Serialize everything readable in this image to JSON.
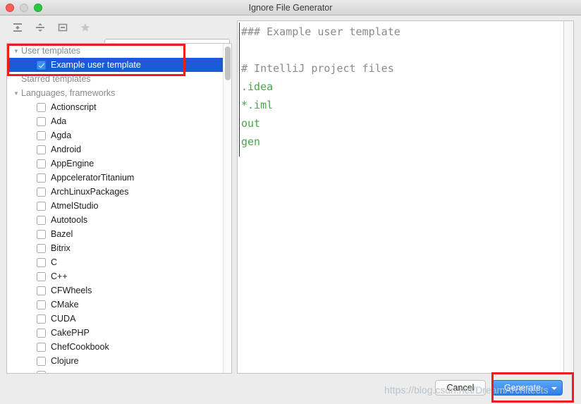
{
  "window": {
    "title": "Ignore File Generator",
    "controls": [
      {
        "name": "close",
        "label": "Close"
      },
      {
        "name": "minimize",
        "label": "Minimize"
      },
      {
        "name": "zoom",
        "label": "Zoom"
      }
    ]
  },
  "toolbar": {
    "buttons": [
      {
        "icon": "expand-all-icon",
        "label": "Expand All"
      },
      {
        "icon": "collapse-all-icon",
        "label": "Collapse All"
      },
      {
        "icon": "panel-toggle-icon",
        "label": "Toggle Panel"
      },
      {
        "icon": "star-icon",
        "label": "Star"
      }
    ]
  },
  "search": {
    "icon": "search-icon",
    "value": "",
    "placeholder": ""
  },
  "tree": {
    "groups": [
      {
        "label": "User templates",
        "expanded": true
      },
      {
        "label": "Starred templates",
        "expanded": false
      },
      {
        "label": "Languages, frameworks",
        "expanded": true
      }
    ],
    "user_template": {
      "label": "Example user template",
      "checked": true,
      "selected": true
    },
    "items": [
      {
        "label": "Actionscript",
        "checked": false
      },
      {
        "label": "Ada",
        "checked": false
      },
      {
        "label": "Agda",
        "checked": false
      },
      {
        "label": "Android",
        "checked": false
      },
      {
        "label": "AppEngine",
        "checked": false
      },
      {
        "label": "AppceleratorTitanium",
        "checked": false
      },
      {
        "label": "ArchLinuxPackages",
        "checked": false
      },
      {
        "label": "AtmelStudio",
        "checked": false
      },
      {
        "label": "Autotools",
        "checked": false
      },
      {
        "label": "Bazel",
        "checked": false
      },
      {
        "label": "Bitrix",
        "checked": false
      },
      {
        "label": "C",
        "checked": false
      },
      {
        "label": "C++",
        "checked": false
      },
      {
        "label": "CFWheels",
        "checked": false
      },
      {
        "label": "CMake",
        "checked": false
      },
      {
        "label": "CUDA",
        "checked": false
      },
      {
        "label": "CakePHP",
        "checked": false
      },
      {
        "label": "ChefCookbook",
        "checked": false
      },
      {
        "label": "Clojure",
        "checked": false
      }
    ]
  },
  "editor": {
    "lines": [
      {
        "text": "### Example user template",
        "style": "comment",
        "highlight": true
      },
      {
        "text": "",
        "style": "plain",
        "highlight": false
      },
      {
        "text": "# IntelliJ project files",
        "style": "comment",
        "highlight": false
      },
      {
        "text": ".idea",
        "style": "green",
        "highlight": false
      },
      {
        "text": "*.iml",
        "style": "green",
        "highlight": false
      },
      {
        "text": "out",
        "style": "green",
        "highlight": false
      },
      {
        "text": "gen",
        "style": "green",
        "highlight": false
      }
    ]
  },
  "footer": {
    "cancel_label": "Cancel",
    "generate_label": "Generate"
  },
  "watermark": {
    "text": "https://blog.csdn.net/DreamArchitects"
  },
  "colors": {
    "selection_blue": "#1b59d6",
    "primary_button": "#2f7de6",
    "annotation_red": "#ee1c1c",
    "code_green": "#4ba64b",
    "code_comment_gray": "#8a8a8a",
    "code_highlight_bg": "#e8f5e5"
  },
  "annotations": [
    {
      "name": "user-template-highlight"
    },
    {
      "name": "generate-button-highlight"
    }
  ]
}
